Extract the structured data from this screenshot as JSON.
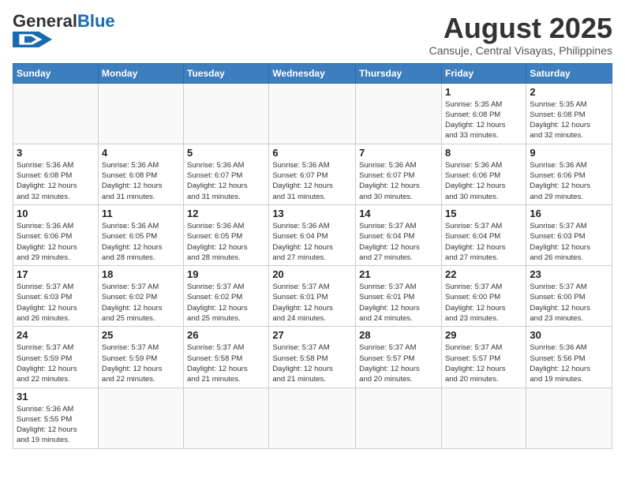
{
  "header": {
    "logo_general": "General",
    "logo_blue": "Blue",
    "month_title": "August 2025",
    "subtitle": "Cansuje, Central Visayas, Philippines"
  },
  "days_of_week": [
    "Sunday",
    "Monday",
    "Tuesday",
    "Wednesday",
    "Thursday",
    "Friday",
    "Saturday"
  ],
  "weeks": [
    [
      {
        "day": "",
        "info": ""
      },
      {
        "day": "",
        "info": ""
      },
      {
        "day": "",
        "info": ""
      },
      {
        "day": "",
        "info": ""
      },
      {
        "day": "",
        "info": ""
      },
      {
        "day": "1",
        "info": "Sunrise: 5:35 AM\nSunset: 6:08 PM\nDaylight: 12 hours\nand 33 minutes."
      },
      {
        "day": "2",
        "info": "Sunrise: 5:35 AM\nSunset: 6:08 PM\nDaylight: 12 hours\nand 32 minutes."
      }
    ],
    [
      {
        "day": "3",
        "info": "Sunrise: 5:36 AM\nSunset: 6:08 PM\nDaylight: 12 hours\nand 32 minutes."
      },
      {
        "day": "4",
        "info": "Sunrise: 5:36 AM\nSunset: 6:08 PM\nDaylight: 12 hours\nand 31 minutes."
      },
      {
        "day": "5",
        "info": "Sunrise: 5:36 AM\nSunset: 6:07 PM\nDaylight: 12 hours\nand 31 minutes."
      },
      {
        "day": "6",
        "info": "Sunrise: 5:36 AM\nSunset: 6:07 PM\nDaylight: 12 hours\nand 31 minutes."
      },
      {
        "day": "7",
        "info": "Sunrise: 5:36 AM\nSunset: 6:07 PM\nDaylight: 12 hours\nand 30 minutes."
      },
      {
        "day": "8",
        "info": "Sunrise: 5:36 AM\nSunset: 6:06 PM\nDaylight: 12 hours\nand 30 minutes."
      },
      {
        "day": "9",
        "info": "Sunrise: 5:36 AM\nSunset: 6:06 PM\nDaylight: 12 hours\nand 29 minutes."
      }
    ],
    [
      {
        "day": "10",
        "info": "Sunrise: 5:36 AM\nSunset: 6:06 PM\nDaylight: 12 hours\nand 29 minutes."
      },
      {
        "day": "11",
        "info": "Sunrise: 5:36 AM\nSunset: 6:05 PM\nDaylight: 12 hours\nand 28 minutes."
      },
      {
        "day": "12",
        "info": "Sunrise: 5:36 AM\nSunset: 6:05 PM\nDaylight: 12 hours\nand 28 minutes."
      },
      {
        "day": "13",
        "info": "Sunrise: 5:36 AM\nSunset: 6:04 PM\nDaylight: 12 hours\nand 27 minutes."
      },
      {
        "day": "14",
        "info": "Sunrise: 5:37 AM\nSunset: 6:04 PM\nDaylight: 12 hours\nand 27 minutes."
      },
      {
        "day": "15",
        "info": "Sunrise: 5:37 AM\nSunset: 6:04 PM\nDaylight: 12 hours\nand 27 minutes."
      },
      {
        "day": "16",
        "info": "Sunrise: 5:37 AM\nSunset: 6:03 PM\nDaylight: 12 hours\nand 26 minutes."
      }
    ],
    [
      {
        "day": "17",
        "info": "Sunrise: 5:37 AM\nSunset: 6:03 PM\nDaylight: 12 hours\nand 26 minutes."
      },
      {
        "day": "18",
        "info": "Sunrise: 5:37 AM\nSunset: 6:02 PM\nDaylight: 12 hours\nand 25 minutes."
      },
      {
        "day": "19",
        "info": "Sunrise: 5:37 AM\nSunset: 6:02 PM\nDaylight: 12 hours\nand 25 minutes."
      },
      {
        "day": "20",
        "info": "Sunrise: 5:37 AM\nSunset: 6:01 PM\nDaylight: 12 hours\nand 24 minutes."
      },
      {
        "day": "21",
        "info": "Sunrise: 5:37 AM\nSunset: 6:01 PM\nDaylight: 12 hours\nand 24 minutes."
      },
      {
        "day": "22",
        "info": "Sunrise: 5:37 AM\nSunset: 6:00 PM\nDaylight: 12 hours\nand 23 minutes."
      },
      {
        "day": "23",
        "info": "Sunrise: 5:37 AM\nSunset: 6:00 PM\nDaylight: 12 hours\nand 23 minutes."
      }
    ],
    [
      {
        "day": "24",
        "info": "Sunrise: 5:37 AM\nSunset: 5:59 PM\nDaylight: 12 hours\nand 22 minutes."
      },
      {
        "day": "25",
        "info": "Sunrise: 5:37 AM\nSunset: 5:59 PM\nDaylight: 12 hours\nand 22 minutes."
      },
      {
        "day": "26",
        "info": "Sunrise: 5:37 AM\nSunset: 5:58 PM\nDaylight: 12 hours\nand 21 minutes."
      },
      {
        "day": "27",
        "info": "Sunrise: 5:37 AM\nSunset: 5:58 PM\nDaylight: 12 hours\nand 21 minutes."
      },
      {
        "day": "28",
        "info": "Sunrise: 5:37 AM\nSunset: 5:57 PM\nDaylight: 12 hours\nand 20 minutes."
      },
      {
        "day": "29",
        "info": "Sunrise: 5:37 AM\nSunset: 5:57 PM\nDaylight: 12 hours\nand 20 minutes."
      },
      {
        "day": "30",
        "info": "Sunrise: 5:36 AM\nSunset: 5:56 PM\nDaylight: 12 hours\nand 19 minutes."
      }
    ],
    [
      {
        "day": "31",
        "info": "Sunrise: 5:36 AM\nSunset: 5:55 PM\nDaylight: 12 hours\nand 19 minutes."
      },
      {
        "day": "",
        "info": ""
      },
      {
        "day": "",
        "info": ""
      },
      {
        "day": "",
        "info": ""
      },
      {
        "day": "",
        "info": ""
      },
      {
        "day": "",
        "info": ""
      },
      {
        "day": "",
        "info": ""
      }
    ]
  ]
}
